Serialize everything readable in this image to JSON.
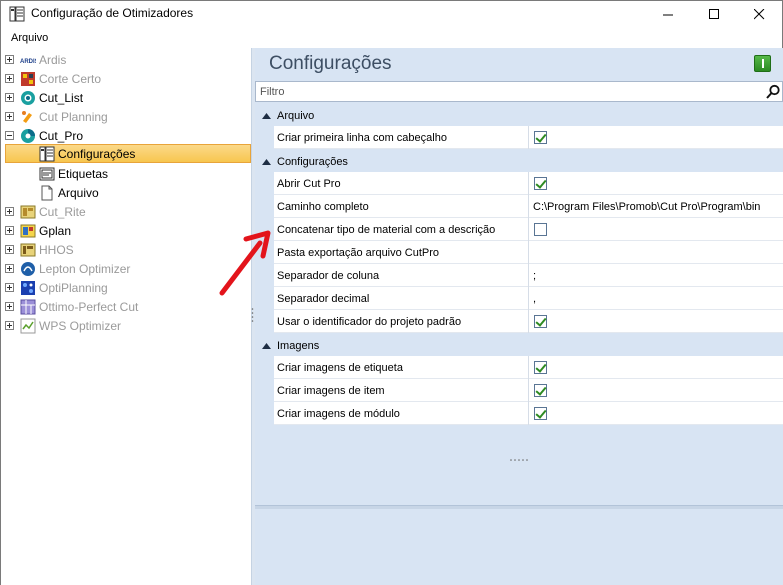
{
  "window": {
    "title": "Configuração de Otimizadores",
    "min_icon": "minimize-icon",
    "max_icon": "maximize-icon",
    "close_icon": "close-icon"
  },
  "menu": {
    "items": [
      {
        "label": "Arquivo"
      }
    ]
  },
  "tree": {
    "items": [
      {
        "label": "Ardis",
        "disabled": true,
        "icon": "ardis-logo-icon"
      },
      {
        "label": "Corte Certo",
        "disabled": true,
        "icon": "corte-certo-icon"
      },
      {
        "label": "Cut_List",
        "disabled": false,
        "icon": "cut-list-icon"
      },
      {
        "label": "Cut Planning",
        "disabled": true,
        "icon": "cut-planning-icon"
      },
      {
        "label": "Cut_Pro",
        "disabled": false,
        "icon": "cut-pro-icon",
        "expanded": true,
        "children": [
          {
            "label": "Configurações",
            "icon": "settings-grid-icon",
            "selected": true
          },
          {
            "label": "Etiquetas",
            "icon": "label-sheet-icon"
          },
          {
            "label": "Arquivo",
            "icon": "file-icon"
          }
        ]
      },
      {
        "label": "Cut_Rite",
        "disabled": true,
        "icon": "cut-rite-icon"
      },
      {
        "label": "Gplan",
        "disabled": false,
        "icon": "gplan-icon"
      },
      {
        "label": "HHOS",
        "disabled": true,
        "icon": "hhos-icon"
      },
      {
        "label": "Lepton Optimizer",
        "disabled": true,
        "icon": "lepton-icon"
      },
      {
        "label": "OptiPlanning",
        "disabled": true,
        "icon": "optiplanning-icon"
      },
      {
        "label": "Ottimo-Perfect Cut",
        "disabled": true,
        "icon": "ottimo-icon"
      },
      {
        "label": "WPS Optimizer",
        "disabled": true,
        "icon": "wps-icon"
      }
    ]
  },
  "panel": {
    "title": "Configurações",
    "filter_placeholder": "Filtro",
    "categories": [
      {
        "label": "Arquivo",
        "props": [
          {
            "name": "Criar primeira linha com cabeçalho",
            "type": "bool",
            "checked": true
          }
        ]
      },
      {
        "label": "Configurações",
        "props": [
          {
            "name": "Abrir Cut Pro",
            "type": "bool",
            "checked": true
          },
          {
            "name": "Caminho completo",
            "type": "text",
            "value": "C:\\Program Files\\Promob\\Cut Pro\\Program\\bin"
          },
          {
            "name": "Concatenar tipo de material com a descrição",
            "type": "bool",
            "checked": false
          },
          {
            "name": "Pasta exportação arquivo CutPro",
            "type": "text",
            "value": ""
          },
          {
            "name": "Separador de coluna",
            "type": "text",
            "value": ";"
          },
          {
            "name": "Separador decimal",
            "type": "text",
            "value": ","
          },
          {
            "name": "Usar o identificador do projeto padrão",
            "type": "bool",
            "checked": true
          }
        ]
      },
      {
        "label": "Imagens",
        "props": [
          {
            "name": "Criar imagens de etiqueta",
            "type": "bool",
            "checked": true
          },
          {
            "name": "Criar imagens de item",
            "type": "bool",
            "checked": true
          },
          {
            "name": "Criar imagens de módulo",
            "type": "bool",
            "checked": true
          }
        ]
      }
    ]
  },
  "colors": {
    "accent_selected": "#f7c64f",
    "panel_bg": "#d8e4f3",
    "annotation_arrow": "#e3141b",
    "check_green": "#2e8b22"
  }
}
